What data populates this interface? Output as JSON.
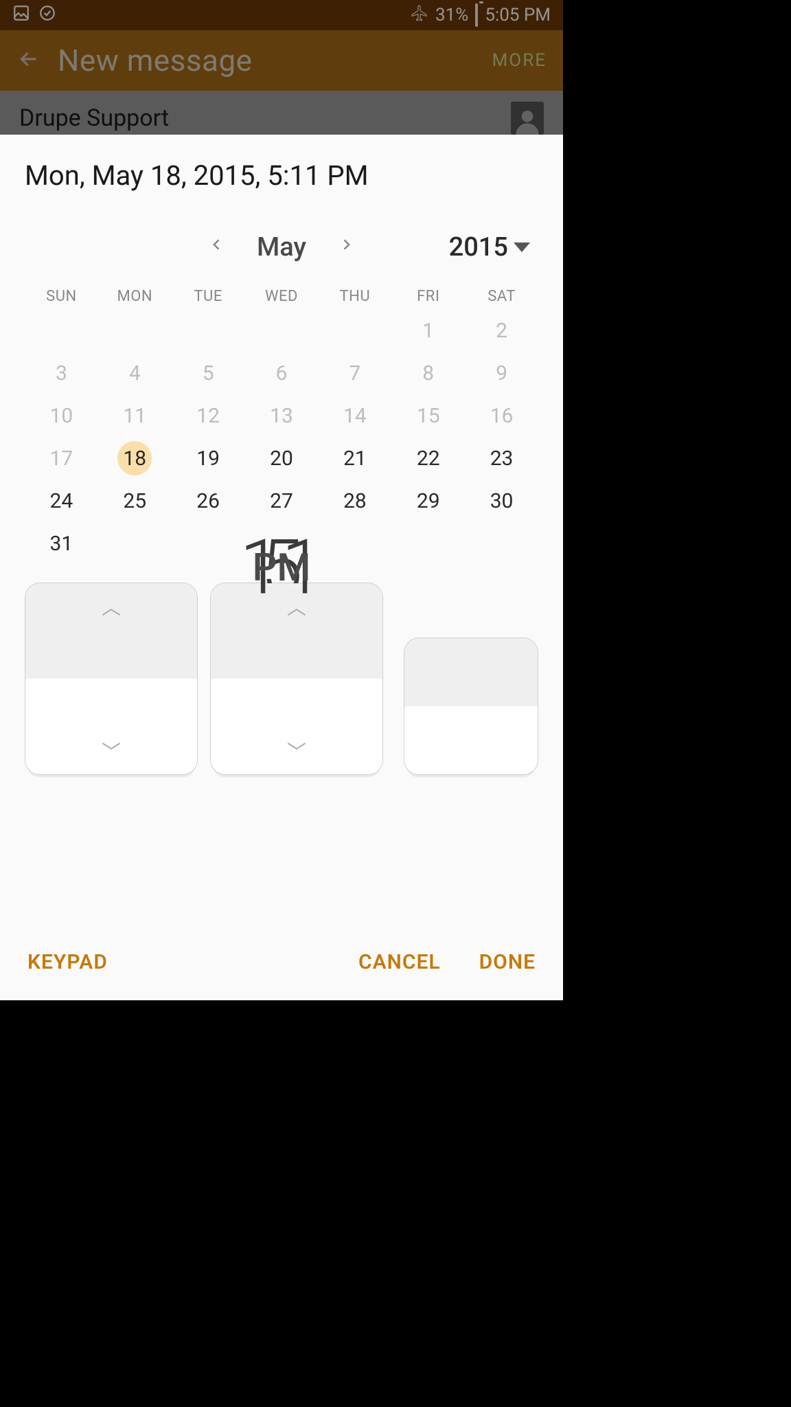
{
  "status": {
    "battery_pct": "31%",
    "time": "5:05 PM"
  },
  "app_bar": {
    "title": "New message",
    "more": "MORE"
  },
  "recipient": {
    "name": "Drupe Support"
  },
  "picker": {
    "header": "Mon, May 18, 2015, 5:11 PM",
    "month": "May",
    "year": "2015",
    "dow": [
      "SUN",
      "MON",
      "TUE",
      "WED",
      "THU",
      "FRI",
      "SAT"
    ],
    "weeks": [
      [
        null,
        null,
        null,
        null,
        null,
        1,
        2
      ],
      [
        3,
        4,
        5,
        6,
        7,
        8,
        9
      ],
      [
        10,
        11,
        12,
        13,
        14,
        15,
        16
      ],
      [
        17,
        18,
        19,
        20,
        21,
        22,
        23
      ],
      [
        24,
        25,
        26,
        27,
        28,
        29,
        30
      ],
      [
        31,
        null,
        null,
        null,
        null,
        null,
        null
      ]
    ],
    "selected_day": 18,
    "past_cutoff": 18,
    "hour": "5",
    "minute": "11",
    "ampm": "PM"
  },
  "actions": {
    "keypad": "KEYPAD",
    "cancel": "CANCEL",
    "done": "DONE"
  }
}
